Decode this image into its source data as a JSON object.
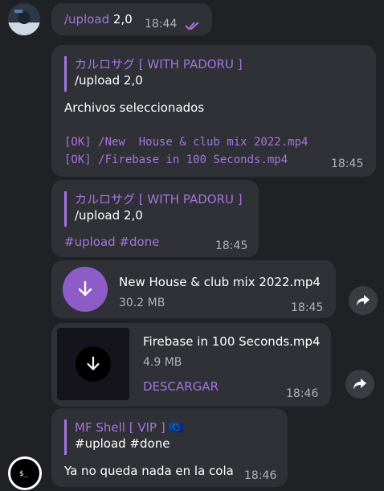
{
  "messages": [
    {
      "text_cmd": "/upload",
      "text_rest": " 2,0",
      "time": "18:44"
    },
    {
      "reply_name": "カルロサグ [ WITH PADORU ]",
      "reply_text": "/upload 2,0",
      "body": "Archivos seleccionados",
      "lines": [
        "[OK] /New  House & club mix 2022.mp4",
        "[OK] /Firebase in 100 Seconds.mp4"
      ],
      "time": "18:45"
    },
    {
      "reply_name": "カルロサグ [ WITH PADORU ]",
      "reply_text": "/upload 2,0",
      "tags": "#upload #done",
      "time": "18:45"
    },
    {
      "file_name": "New  House & club mix 2022.mp4",
      "file_size": "30.2 MB",
      "time": "18:45"
    },
    {
      "file_name": "Firebase in 100 Seconds.mp4",
      "file_size": "4.9 MB",
      "action": "DESCARGAR",
      "time": "18:46"
    },
    {
      "reply_name": "MF Shell [ VIP ] 🇪🇺",
      "reply_text": "#upload #done",
      "body": "Ya no queda nada en la cola",
      "time": "18:46"
    }
  ],
  "icons": {
    "read_receipt": "double-check-icon",
    "forward": "share-arrow-icon",
    "download": "download-arrow-icon"
  },
  "colors": {
    "accent": "#a275e0",
    "background": "#202124",
    "bubble": "#2f3136"
  }
}
